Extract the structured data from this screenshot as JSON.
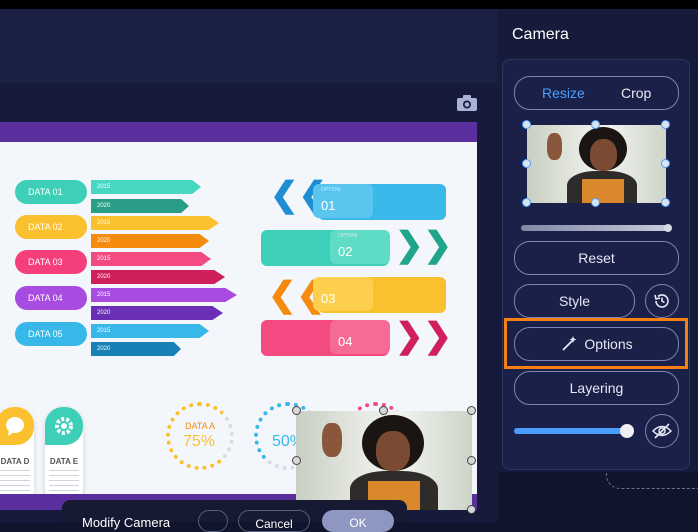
{
  "panel": {
    "title": "Camera",
    "tabs": [
      "Resize",
      "Crop"
    ],
    "reset_label": "Reset",
    "style_label": "Style",
    "options_label": "Options",
    "layering_label": "Layering",
    "opacity_fraction": 0.96
  },
  "slide": {
    "data_labels": [
      "DATA 01",
      "DATA 02",
      "DATA 03",
      "DATA 04",
      "DATA 05"
    ],
    "data_colors": [
      "#3ecfb8",
      "#fbc02d",
      "#f43f7a",
      "#a84be0",
      "#37b8e8"
    ],
    "years": [
      "2015",
      "2020"
    ],
    "options": [
      {
        "small": "OPTION",
        "number": "01"
      },
      {
        "small": "OPTION",
        "number": "02"
      },
      {
        "small": "",
        "number": "03"
      },
      {
        "small": "",
        "number": "04"
      }
    ],
    "cards": [
      "DATA D",
      "DATA E"
    ],
    "rings": [
      {
        "label": "DATA A",
        "value": "75%"
      },
      {
        "label": "",
        "value": "50%"
      }
    ]
  },
  "bottom_bar": {
    "text": "Modify Camera",
    "secondary": "Cancel",
    "primary": "OK"
  },
  "colors": {
    "accent_blue": "#4a9eff",
    "highlight_orange": "#f47f12",
    "slide_purple": "#5a2e9c"
  }
}
